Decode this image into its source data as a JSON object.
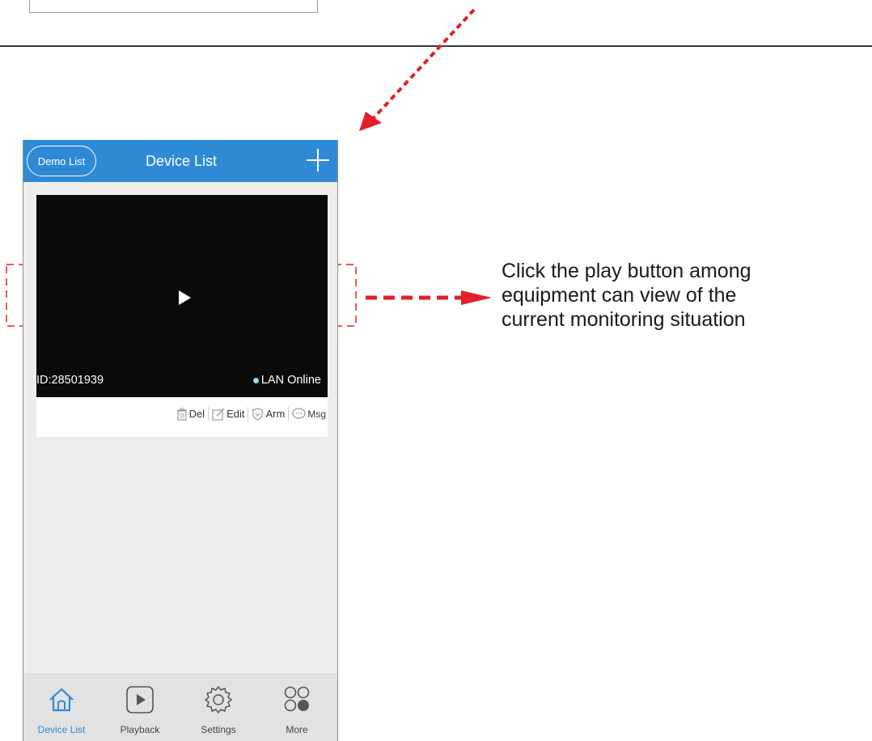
{
  "navbar": {
    "demo_label": "Demo List",
    "title": "Device List",
    "add_icon": "plus-icon"
  },
  "device": {
    "id_text": "ID:28501939",
    "status_text": "LAN Online",
    "status_color": "#9fd6f2",
    "play_icon": "play-icon"
  },
  "actions": [
    {
      "label": "Del",
      "icon": "trash-icon"
    },
    {
      "label": "Edit",
      "icon": "edit-icon"
    },
    {
      "label": "Arm",
      "icon": "shield-icon"
    },
    {
      "label": "Msg",
      "icon": "message-icon"
    }
  ],
  "tabs": [
    {
      "label": "Device List",
      "icon": "home-icon",
      "active": true
    },
    {
      "label": "Playback",
      "icon": "playback-icon",
      "active": false
    },
    {
      "label": "Settings",
      "icon": "gear-icon",
      "active": false
    },
    {
      "label": "More",
      "icon": "more-icon",
      "active": false
    }
  ],
  "annotation": {
    "lines": [
      "Click the play button among",
      "equipment can view of the",
      "current monitoring situation"
    ],
    "color": "#e0202a"
  },
  "colors": {
    "accent": "#2f8ad6",
    "annotation": "#e0202a"
  }
}
